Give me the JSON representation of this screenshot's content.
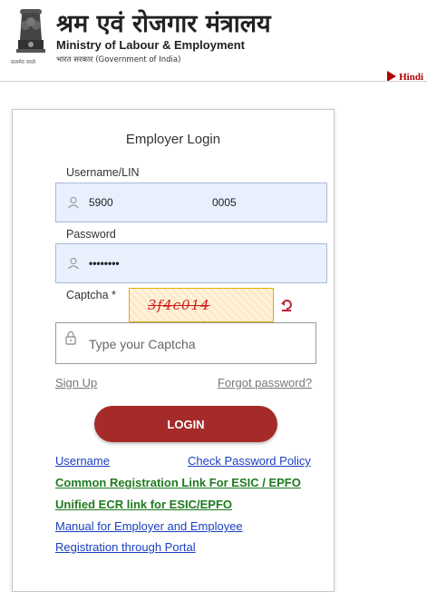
{
  "header": {
    "ministry_hindi": "श्रम एवं रोजगार मंत्रालय",
    "ministry_english": "Ministry of Labour & Employment",
    "government": "भारत सरकार (Government of India)",
    "emblem_motto": "सत्यमेव जयते",
    "language_link": "Hindi"
  },
  "login": {
    "title": "Employer Login",
    "username_label": "Username/LIN",
    "username_value": "5900",
    "username_value_end": "0005",
    "password_label": "Password",
    "password_value": "••••••••",
    "captcha_label": "Captcha *",
    "captcha_text": "3f4c014",
    "captcha_placeholder": "Type your Captcha",
    "signup_link": "Sign Up",
    "forgot_link": "Forgot password?",
    "login_button": "LOGIN"
  },
  "links": {
    "username": "Username",
    "check_password_policy": "Check Password Policy",
    "common_registration": "Common Registration Link For ESIC / EPFO",
    "unified_ecr": "Unified ECR link for ESIC/EPFO",
    "manual": "Manual for Employer and Employee",
    "registration_portal": "Registration through Portal"
  },
  "colors": {
    "accent": "#a52a2a",
    "link": "#1a3fbf",
    "green_link": "#1e7a1e",
    "field_bg": "#e8f0fe",
    "captcha_text": "#d01c1c"
  },
  "icons": [
    "national-emblem-icon",
    "hindi-arrow-icon",
    "user-icon",
    "lock-icon",
    "refresh-icon"
  ]
}
